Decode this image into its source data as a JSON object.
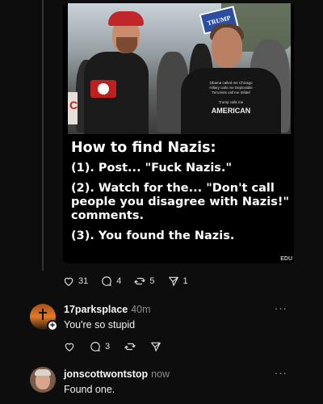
{
  "post": {
    "image": {
      "sign_text": "TRUMP",
      "left_sign_text": "C",
      "shirt_lines": [
        "Obama called me Chicago",
        "Hillary calls me Deplorable",
        "Terrorists call me Infidel"
      ],
      "shirt_trump_line": "Trump calls me",
      "shirt_big": "AMERICAN",
      "caption_title": "How to find Nazis:",
      "step1": "(1). Post... \"Fuck Nazis.\"",
      "step2": "(2). Watch for the... \"Don't call people you disagree with Nazis!\" comments.",
      "step3": "(3). You found the Nazis.",
      "watermark": "EDU"
    },
    "actions": {
      "likes": "31",
      "comments": "4",
      "reposts": "5",
      "shares": "1"
    }
  },
  "replies": [
    {
      "username": "17parksplace",
      "time": "40m",
      "text": "You're so stupid",
      "comments": "3",
      "more": "···"
    },
    {
      "username": "jonscottwontstop",
      "time": "now",
      "text": "Found one.",
      "more": "···"
    }
  ],
  "colors": {
    "background": "#0d0d0d",
    "text": "#f2f2f2",
    "muted": "#8a8a8a",
    "cap_red": "#c0262a"
  }
}
